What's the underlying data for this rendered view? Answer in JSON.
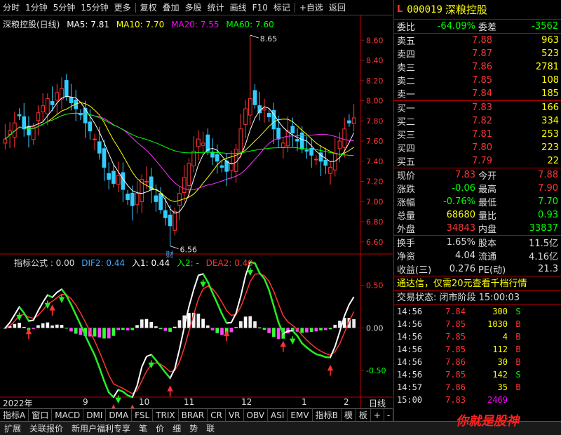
{
  "toolbar": {
    "items": [
      "分时",
      "1分钟",
      "5分钟",
      "15分钟",
      "更多",
      "复权",
      "叠加",
      "多股",
      "统计",
      "画线",
      "F10",
      "标记",
      "+自选",
      "返回"
    ]
  },
  "main_legend": {
    "title": "深粮控股(日线)",
    "ma5": "MA5: 7.81",
    "ma10": "MA10: 7.70",
    "ma20": "MA20: 7.55",
    "ma60": "MA60: 7.60"
  },
  "sub_legend": {
    "title": "指标公式 : 0.00",
    "dif": "DIF2: 0.44",
    "rj1": "入1: 0.44",
    "rj2": "入2: -",
    "dea": "DEA2: 0.40"
  },
  "annotations": {
    "high": "8.65",
    "low": "6.56",
    "cai": "财"
  },
  "x_dates": [
    "2022年",
    "9",
    "10",
    "11",
    "12",
    "1",
    "2",
    "日线"
  ],
  "chart_data": [
    {
      "type": "candlestick",
      "title": "深粮控股(日线)",
      "yaxis_ticks": [
        8.6,
        8.4,
        8.2,
        8.0,
        7.8,
        7.6,
        7.4,
        7.2,
        7.0,
        6.8,
        6.6
      ],
      "ylim": [
        6.55,
        8.72
      ],
      "high": 8.65,
      "low": 6.56,
      "series": [
        {
          "name": "MA5",
          "color": "#ffffff",
          "last": 7.81
        },
        {
          "name": "MA10",
          "color": "#ffff00",
          "last": 7.7
        },
        {
          "name": "MA20",
          "color": "#ff00ff",
          "last": 7.55
        },
        {
          "name": "MA60",
          "color": "#00ff00",
          "last": 7.6
        }
      ],
      "closes": [
        7.62,
        7.7,
        7.78,
        7.85,
        7.72,
        7.66,
        7.74,
        7.88,
        7.95,
        8.02,
        7.96,
        8.08,
        8.12,
        8.04,
        7.98,
        7.92,
        7.86,
        7.78,
        7.7,
        7.62,
        7.48,
        7.34,
        7.22,
        7.18,
        7.26,
        7.12,
        7.02,
        6.96,
        7.08,
        7.22,
        7.2,
        7.12,
        7.0,
        6.92,
        6.84,
        6.76,
        6.9,
        7.08,
        7.24,
        7.38,
        7.5,
        7.62,
        7.58,
        7.5,
        7.44,
        7.4,
        7.34,
        7.3,
        7.38,
        7.52,
        7.72,
        7.92,
        8.02,
        7.96,
        7.88,
        7.92,
        7.84,
        7.72,
        7.62,
        7.58,
        7.7,
        7.68,
        7.6,
        7.52,
        7.5,
        7.46,
        7.42,
        7.4,
        7.36,
        7.34,
        7.48,
        7.6,
        7.72,
        7.78,
        7.83
      ]
    },
    {
      "type": "line",
      "title": "指标公式",
      "yaxis_ticks": [
        0.5,
        0.0,
        -0.5
      ],
      "ylim": [
        -0.78,
        0.72
      ],
      "series": [
        {
          "name": "DIF2",
          "color": "#ffffff",
          "last": 0.44
        },
        {
          "name": "入1",
          "color": "#ffffff",
          "last": 0.44
        },
        {
          "name": "DEA2",
          "color": "#ff3333",
          "last": 0.4
        }
      ]
    }
  ],
  "quote": {
    "prefix": "L",
    "code": "000019",
    "name": "深粮控股",
    "weibi_label": "委比",
    "weibi": "-64.09%",
    "weicha_label": "委差",
    "weicha": "-3562",
    "sells": [
      {
        "label": "卖五",
        "price": "7.88",
        "vol": "963"
      },
      {
        "label": "卖四",
        "price": "7.87",
        "vol": "523"
      },
      {
        "label": "卖三",
        "price": "7.86",
        "vol": "2781"
      },
      {
        "label": "卖二",
        "price": "7.85",
        "vol": "108"
      },
      {
        "label": "卖一",
        "price": "7.84",
        "vol": "185"
      }
    ],
    "buys": [
      {
        "label": "买一",
        "price": "7.83",
        "vol": "166"
      },
      {
        "label": "买二",
        "price": "7.82",
        "vol": "334"
      },
      {
        "label": "买三",
        "price": "7.81",
        "vol": "253"
      },
      {
        "label": "买四",
        "price": "7.80",
        "vol": "223"
      },
      {
        "label": "买五",
        "price": "7.79",
        "vol": "22"
      }
    ],
    "stats": [
      {
        "a": "现价",
        "av": "7.83",
        "b": "今开",
        "bv": "7.88"
      },
      {
        "a": "涨跌",
        "av": "-0.06",
        "b": "最高",
        "bv": "7.90"
      },
      {
        "a": "涨幅",
        "av": "-0.76%",
        "b": "最低",
        "bv": "7.70"
      },
      {
        "a": "总量",
        "av": "68680",
        "b": "量比",
        "bv": "0.93"
      },
      {
        "a": "外盘",
        "av": "34843",
        "b": "内盘",
        "bv": "33837"
      }
    ],
    "stats2": [
      {
        "a": "换手",
        "av": "1.65%",
        "b": "股本",
        "bv": "11.5亿"
      },
      {
        "a": "净资",
        "av": "4.04",
        "b": "流通",
        "bv": "4.16亿"
      },
      {
        "a": "收益(三)",
        "av": "0.276",
        "b": "PE(动)",
        "bv": "21.3"
      }
    ],
    "ad": "通达信，仅需20元查看千档行情",
    "status": "交易状态: 闭市阶段 15:00:03",
    "ticks": [
      {
        "t": "14:56",
        "p": "7.84",
        "v": "300",
        "bs": "S"
      },
      {
        "t": "14:56",
        "p": "7.85",
        "v": "1030",
        "bs": "B"
      },
      {
        "t": "14:56",
        "p": "7.85",
        "v": "4",
        "bs": "B"
      },
      {
        "t": "14:56",
        "p": "7.85",
        "v": "112",
        "bs": "B"
      },
      {
        "t": "14:56",
        "p": "7.86",
        "v": "30",
        "bs": "B"
      },
      {
        "t": "14:56",
        "p": "7.85",
        "v": "142",
        "bs": "S"
      },
      {
        "t": "14:57",
        "p": "7.86",
        "v": "35",
        "bs": "B"
      },
      {
        "t": "15:00",
        "p": "7.83",
        "v": "2469",
        "bs": ""
      }
    ]
  },
  "tabs1": [
    "指标A",
    "窗口",
    "MACD",
    "DMI",
    "DMA",
    "FSL",
    "TRIX",
    "BRAR",
    "CR",
    "VR",
    "OBV",
    "ASI",
    "EMV",
    "指标B",
    "模",
    "板",
    "+",
    "-"
  ],
  "tabs2": [
    "扩展",
    "关联报价",
    "新用户福利专享",
    "笔",
    "价",
    "细",
    "势",
    "联"
  ],
  "logo_text": "你就是股神"
}
